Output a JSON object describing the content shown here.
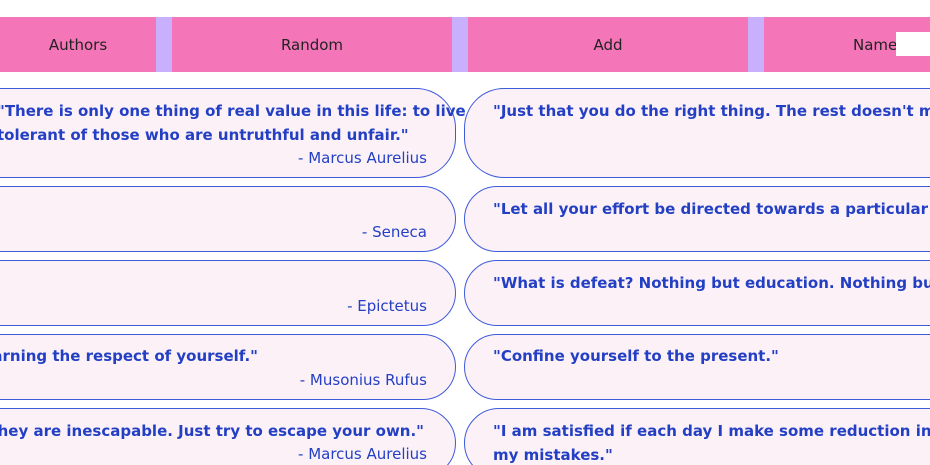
{
  "nav": {
    "authors_label": "Authors",
    "random_label": "Random",
    "add_label": "Add",
    "name_label": "Name",
    "name_value": ""
  },
  "colors": {
    "tab": "#f576b8",
    "separator": "#c8b0ff",
    "card_bg": "#fdf1f8",
    "card_border": "#3d5bd9",
    "text": "#2340c4"
  },
  "left_cards": [
    {
      "quote_line1": "\"There is only one thing of real value in this life: to live one’s life truthfully and fairly and be",
      "quote_line2": "tolerant of those who are untruthful and unfair.\"",
      "author": "- Marcus Aurelius"
    },
    {
      "quote_line1": "",
      "quote_line2": "",
      "author": "- Seneca"
    },
    {
      "quote_line1": "",
      "quote_line2": "",
      "author": "- Epictetus"
    },
    {
      "quote_line1": "\"If you want to be respected, begin by earning the respect of yourself.\"",
      "quote_line2": "",
      "author": "- Musonius Rufus"
    },
    {
      "quote_line1": "\"Don't try to escape your faults. They are inescapable. Just try to escape your own.\"",
      "quote_line2": "",
      "author": "- Marcus Aurelius"
    }
  ],
  "right_cards": [
    {
      "quote_line1": "\"Just that you do the right thing. The rest doesn't matter.\"",
      "quote_line2": ""
    },
    {
      "quote_line1": "\"Let all your effort be directed towards a particular aim and keep",
      "quote_line2": ""
    },
    {
      "quote_line1": "\"What is defeat? Nothing but education. Nothing but the first",
      "quote_line2": ""
    },
    {
      "quote_line1": "\"Confine yourself to the present.\"",
      "quote_line2": ""
    },
    {
      "quote_line1": "\"I am satisfied if each day I make some reduction in the number of",
      "quote_line2": "my mistakes.\""
    }
  ]
}
